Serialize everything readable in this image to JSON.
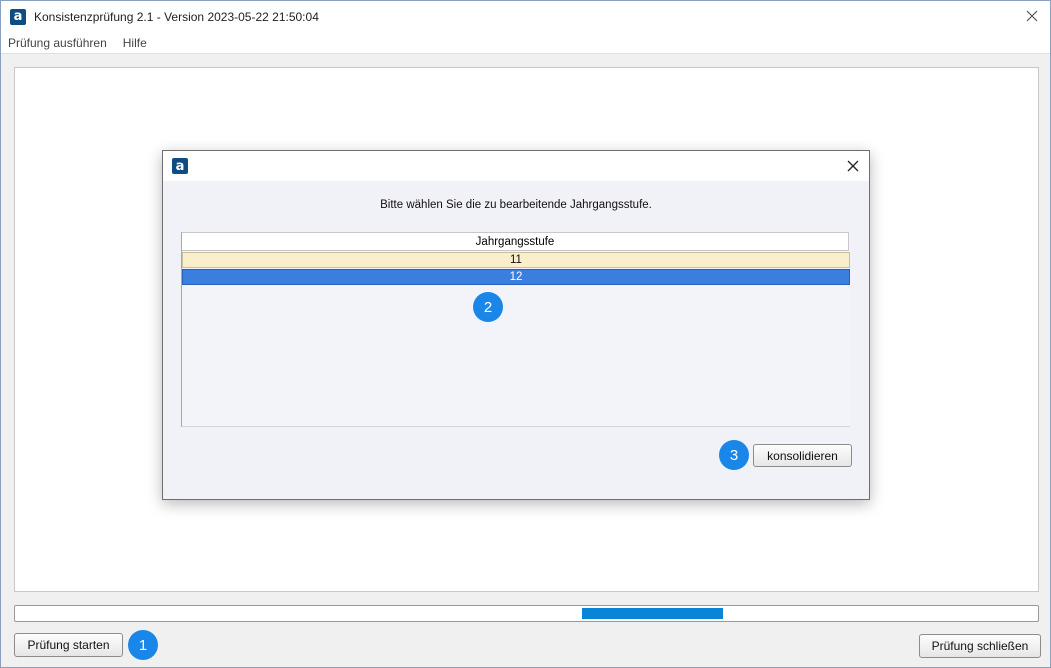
{
  "window": {
    "title": "Konsistenzprüfung 2.1 - Version 2023-05-22 21:50:04",
    "app_icon": "a"
  },
  "menu": {
    "items": [
      "Prüfung ausführen",
      "Hilfe"
    ]
  },
  "progress": {
    "fill_start_fraction": 0.554,
    "fill_end_fraction": 0.692,
    "color": "#0a84d6"
  },
  "buttons": {
    "start": "Prüfung starten",
    "close": "Prüfung schließen"
  },
  "markers": [
    "1",
    "2",
    "3"
  ],
  "dialog": {
    "app_icon": "a",
    "prompt": "Bitte wählen Sie die zu bearbeitende Jahrgangsstufe.",
    "table": {
      "header": "Jahrgangsstufe",
      "rows": [
        "11",
        "12"
      ],
      "selected_index": 1
    },
    "consolidate": "konsolidieren"
  },
  "icons": {
    "window_close": "close-icon",
    "dialog_close": "close-icon"
  },
  "colors": {
    "marker": "#1a87e8",
    "selected_row": "#3a7fe0",
    "unselected_row": "#fbeecb"
  }
}
